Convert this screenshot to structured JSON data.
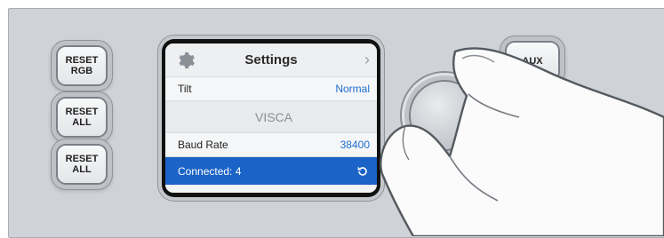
{
  "buttons": {
    "reset_rgb": "RESET\nRGB",
    "reset_all_1": "RESET\nALL",
    "reset_all_2": "RESET\nALL",
    "aux": "AUX"
  },
  "lcd": {
    "title": "Settings",
    "rows": [
      {
        "label": "Tilt",
        "value": "Normal"
      },
      {
        "label": "VISCA"
      },
      {
        "label": "Baud Rate",
        "value": "38400"
      }
    ],
    "status": "Connected: 4"
  },
  "colors": {
    "accent": "#1b63c6",
    "value_text": "#1e6fd0"
  },
  "icons": [
    "gear-icon",
    "chevron-right-icon",
    "refresh-icon"
  ]
}
